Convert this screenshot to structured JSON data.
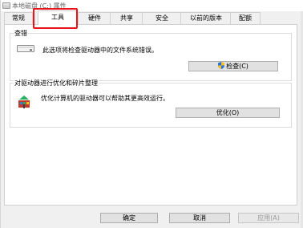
{
  "window": {
    "title": "本地磁盘 (C:) 属性"
  },
  "tabs": [
    {
      "label": "常规"
    },
    {
      "label": "工具"
    },
    {
      "label": "硬件"
    },
    {
      "label": "共享"
    },
    {
      "label": "安全"
    },
    {
      "label": "以前的版本"
    },
    {
      "label": "配额"
    }
  ],
  "active_tab": "工具",
  "error_check": {
    "title": "查错",
    "description": "此选项将检查驱动器中的文件系统错误。",
    "button_label": "检查(C)",
    "icon": "drive-icon"
  },
  "optimize": {
    "title": "对驱动器进行优化和碎片整理",
    "description": "优化计算机的驱动器可以帮助其更高效运行。",
    "button_label": "优化(O)",
    "icon": "defrag-icon"
  },
  "footer": {
    "ok_label": "确定",
    "cancel_label": "取消",
    "apply_label": "应用(A)"
  },
  "colors": {
    "highlight": "#e8141a",
    "window_bg": "#f0f0f0",
    "panel_bg": "#ffffff"
  }
}
